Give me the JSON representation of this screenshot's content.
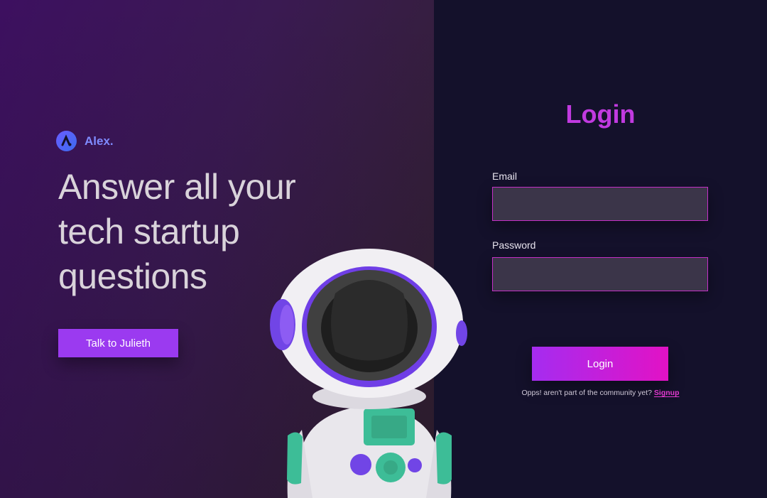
{
  "brand": {
    "name": "Alex.",
    "logo_icon": "alex-logo-icon"
  },
  "hero": {
    "headline_line1": "Answer all your",
    "headline_line2": "tech startup",
    "headline_line3": "questions",
    "cta_label": "Talk to Julieth"
  },
  "login": {
    "title": "Login",
    "email_label": "Email",
    "email_value": "",
    "password_label": "Password",
    "password_value": "",
    "submit_label": "Login",
    "signup_prompt": "Opps! aren't part of the community yet?",
    "signup_link": "Signup"
  },
  "colors": {
    "accent_purple": "#9b3af0",
    "accent_magenta": "#e212c5",
    "panel_dark": "#14112b",
    "field_bg": "#3b3549",
    "field_border": "#c42fc6"
  },
  "illustration": {
    "icon": "astronaut-illustration"
  }
}
